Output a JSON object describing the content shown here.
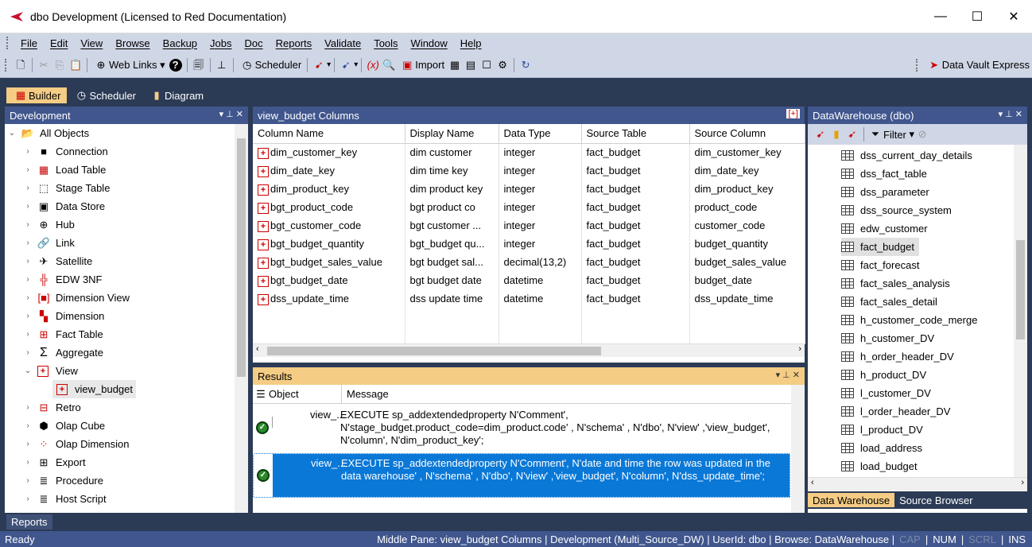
{
  "window": {
    "title": "dbo  Development  (Licensed to Red Documentation)"
  },
  "menu": [
    "File",
    "Edit",
    "View",
    "Browse",
    "Backup",
    "Jobs",
    "Doc",
    "Reports",
    "Validate",
    "Tools",
    "Window",
    "Help"
  ],
  "toolbar": {
    "weblinks": "Web Links",
    "scheduler": "Scheduler",
    "import": "Import",
    "dve": "Data Vault Express"
  },
  "tabs": {
    "builder": "Builder",
    "scheduler": "Scheduler",
    "diagram": "Diagram"
  },
  "left": {
    "header": "Development",
    "root": "All Objects",
    "items": [
      "Connection",
      "Load Table",
      "Stage Table",
      "Data Store",
      "Hub",
      "Link",
      "Satellite",
      "EDW 3NF",
      "Dimension View",
      "Dimension",
      "Fact Table",
      "Aggregate",
      "View",
      "view_budget",
      "Retro",
      "Olap Cube",
      "Olap Dimension",
      "Export",
      "Procedure",
      "Host Script"
    ]
  },
  "columns": {
    "header": "view_budget Columns",
    "headers": [
      "Column Name",
      "Display Name",
      "Data Type",
      "Source Table",
      "Source Column"
    ],
    "rows": [
      [
        "dim_customer_key",
        "dim customer",
        "integer",
        "fact_budget",
        "dim_customer_key"
      ],
      [
        "dim_date_key",
        "dim time key",
        "integer",
        "fact_budget",
        "dim_date_key"
      ],
      [
        "dim_product_key",
        "dim product key",
        "integer",
        "fact_budget",
        "dim_product_key"
      ],
      [
        "bgt_product_code",
        "bgt product co",
        "integer",
        "fact_budget",
        "product_code"
      ],
      [
        "bgt_customer_code",
        "bgt customer ...",
        "integer",
        "fact_budget",
        "customer_code"
      ],
      [
        "bgt_budget_quantity",
        "bgt_budget qu...",
        "integer",
        "fact_budget",
        "budget_quantity"
      ],
      [
        "bgt_budget_sales_value",
        "bgt budget sal...",
        "decimal(13,2)",
        "fact_budget",
        "budget_sales_value"
      ],
      [
        "bgt_budget_date",
        "bgt budget date",
        "datetime",
        "fact_budget",
        "budget_date"
      ],
      [
        "dss_update_time",
        "dss update time",
        "datetime",
        "fact_budget",
        "dss_update_time"
      ]
    ]
  },
  "results": {
    "header": "Results",
    "col_object": "Object",
    "col_message": "Message",
    "rows": [
      {
        "object": "view_...",
        "message": "EXECUTE sp_addextendedproperty N'Comment', N'stage_budget.product_code=dim_product.code' , N'schema' , N'dbo', N'view' ,'view_budget', N'column', N'dim_product_key';"
      },
      {
        "object": "view_...",
        "message": "EXECUTE sp_addextendedproperty N'Comment', N'date and time the row was updated in the data warehouse' , N'schema' , N'dbo', N'view' ,'view_budget', N'column', N'dss_update_time';"
      }
    ]
  },
  "right": {
    "header": "DataWarehouse (dbo)",
    "filter": "Filter",
    "items": [
      "dss_current_day_details",
      "dss_fact_table",
      "dss_parameter",
      "dss_source_system",
      "edw_customer",
      "fact_budget",
      "fact_forecast",
      "fact_sales_analysis",
      "fact_sales_detail",
      "h_customer_code_merge",
      "h_customer_DV",
      "h_order_header_DV",
      "h_product_DV",
      "l_customer_DV",
      "l_order_header_DV",
      "l_product_DV",
      "load_address",
      "load_budget"
    ],
    "tab_dw": "Data Warehouse",
    "tab_src": "Source Browser"
  },
  "reports": "Reports",
  "status": {
    "left": "Ready",
    "right": "Middle Pane: view_budget Columns | Development (Multi_Source_DW) | UserId: dbo | Browse: DataWarehouse |",
    "cap": "CAP",
    "num": "NUM",
    "scrl": "SCRL",
    "ins": "INS"
  }
}
